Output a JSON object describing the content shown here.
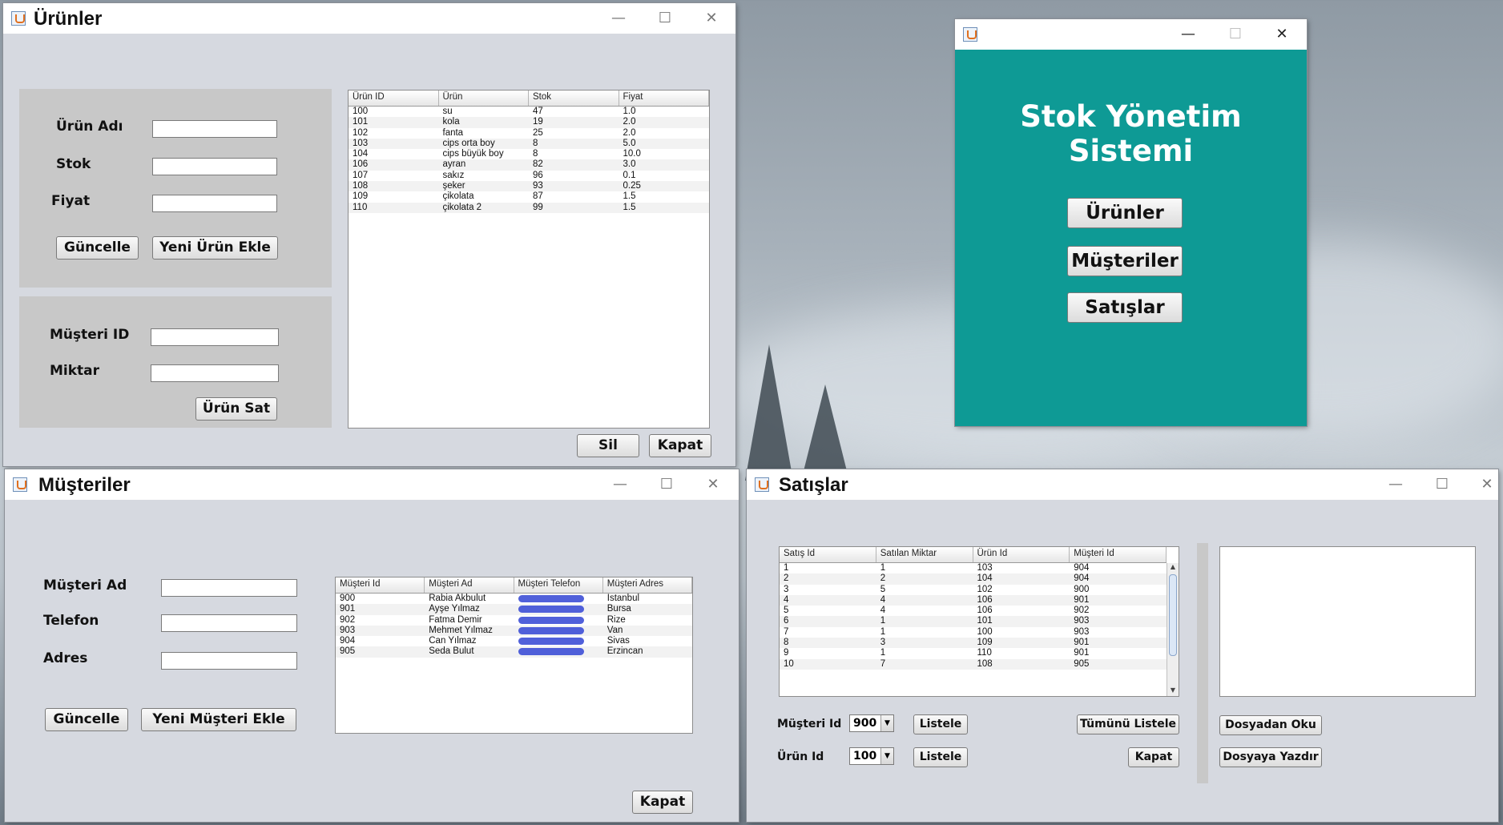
{
  "urunler": {
    "title": "Ürünler",
    "labels": {
      "name": "Ürün Adı",
      "stock": "Stok",
      "price": "Fiyat",
      "customer_id": "Müşteri ID",
      "quantity": "Miktar"
    },
    "buttons": {
      "update": "Güncelle",
      "add": "Yeni Ürün Ekle",
      "sell": "Ürün Sat",
      "delete": "Sil",
      "close": "Kapat"
    },
    "table": {
      "headers": [
        "Ürün ID",
        "Ürün",
        "Stok",
        "Fiyat"
      ],
      "rows": [
        [
          "100",
          "su",
          "47",
          "1.0"
        ],
        [
          "101",
          "kola",
          "19",
          "2.0"
        ],
        [
          "102",
          "fanta",
          "25",
          "2.0"
        ],
        [
          "103",
          "cips orta boy",
          "8",
          "5.0"
        ],
        [
          "104",
          "cips büyük boy",
          "8",
          "10.0"
        ],
        [
          "106",
          "ayran",
          "82",
          "3.0"
        ],
        [
          "107",
          "sakız",
          "96",
          "0.1"
        ],
        [
          "108",
          "şeker",
          "93",
          "0.25"
        ],
        [
          "109",
          "çikolata",
          "87",
          "1.5"
        ],
        [
          "110",
          "çikolata 2",
          "99",
          "1.5"
        ]
      ]
    }
  },
  "ana": {
    "heading": "Stok Yönetim Sistemi",
    "buttons": {
      "products": "Ürünler",
      "customers": "Müşteriler",
      "sales": "Satışlar"
    }
  },
  "musteriler": {
    "title": "Müşteriler",
    "labels": {
      "name": "Müşteri Ad",
      "phone": "Telefon",
      "address": "Adres"
    },
    "buttons": {
      "update": "Güncelle",
      "add": "Yeni Müşteri Ekle",
      "close": "Kapat"
    },
    "table": {
      "headers": [
        "Müşteri Id",
        "Müşteri Ad",
        "Müşteri Telefon",
        "Müşteri Adres"
      ],
      "rows": [
        [
          "900",
          "Rabia Akbulut",
          "İstanbul"
        ],
        [
          "901",
          "Ayşe Yılmaz",
          "Bursa"
        ],
        [
          "902",
          "Fatma Demir",
          "Rize"
        ],
        [
          "903",
          "Mehmet Yılmaz",
          "Van"
        ],
        [
          "904",
          "Can Yılmaz",
          "Sivas"
        ],
        [
          "905",
          "Seda Bulut",
          "Erzincan"
        ]
      ]
    }
  },
  "satislar": {
    "title": "Satışlar",
    "labels": {
      "customer_id": "Müşteri Id",
      "product_id": "Ürün Id"
    },
    "combos": {
      "customer": "900",
      "product": "100"
    },
    "buttons": {
      "list": "Listele",
      "list_all": "Tümünü Listele",
      "close": "Kapat",
      "read_file": "Dosyadan Oku",
      "write_file": "Dosyaya Yazdır"
    },
    "table": {
      "headers": [
        "Satış Id",
        "Satılan Miktar",
        "Ürün Id",
        "Müşteri Id"
      ],
      "rows": [
        [
          "1",
          "1",
          "103",
          "904"
        ],
        [
          "2",
          "2",
          "104",
          "904"
        ],
        [
          "3",
          "5",
          "102",
          "900"
        ],
        [
          "4",
          "4",
          "106",
          "901"
        ],
        [
          "5",
          "4",
          "106",
          "902"
        ],
        [
          "6",
          "1",
          "101",
          "903"
        ],
        [
          "7",
          "1",
          "100",
          "903"
        ],
        [
          "8",
          "3",
          "109",
          "901"
        ],
        [
          "9",
          "1",
          "110",
          "901"
        ],
        [
          "10",
          "7",
          "108",
          "905"
        ]
      ]
    }
  },
  "window_controls": {
    "minimize": "—",
    "maximize": "☐",
    "close": "✕"
  },
  "colors": {
    "teal": "#0e9a95",
    "panel": "#c8c8c8",
    "window_bg": "#d6d9e0"
  }
}
